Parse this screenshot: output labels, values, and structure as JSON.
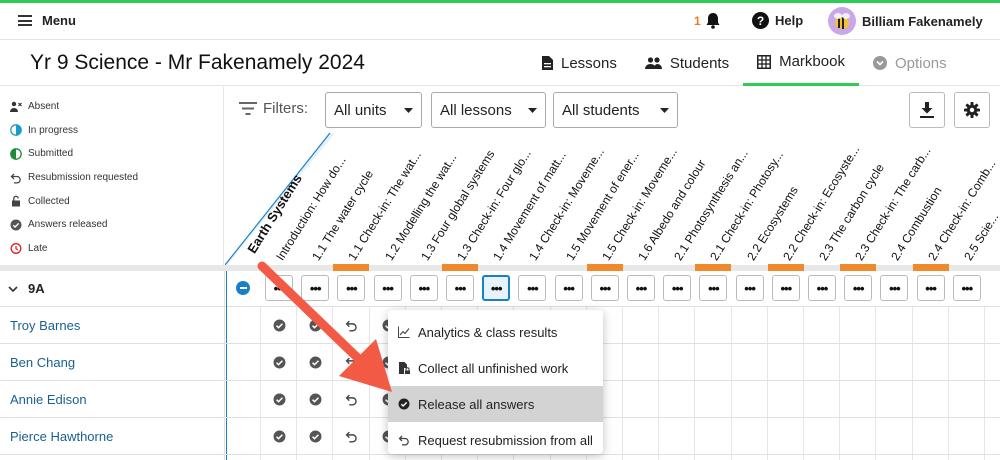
{
  "topbar": {
    "menu_label": "Menu",
    "notification_count": "1",
    "help_label": "Help",
    "user_name": "Billiam Fakenamely"
  },
  "header": {
    "title": "Yr 9 Science - Mr Fakenamely 2024",
    "tabs": [
      {
        "label": "Lessons",
        "icon": "document-icon"
      },
      {
        "label": "Students",
        "icon": "people-icon"
      },
      {
        "label": "Markbook",
        "icon": "grid-icon",
        "active": true
      },
      {
        "label": "Options",
        "icon": "chevron-circle-icon",
        "disabled": true
      }
    ]
  },
  "legend": [
    {
      "label": "Absent",
      "icon": "absent-icon"
    },
    {
      "label": "In progress",
      "icon": "half-circle-blue-icon"
    },
    {
      "label": "Submitted",
      "icon": "half-circle-green-icon"
    },
    {
      "label": "Resubmission requested",
      "icon": "undo-icon"
    },
    {
      "label": "Collected",
      "icon": "lock-icon"
    },
    {
      "label": "Answers released",
      "icon": "check-circle-icon"
    },
    {
      "label": "Late",
      "icon": "clock-icon"
    }
  ],
  "filters": {
    "label": "Filters:",
    "units": "All units",
    "lessons": "All lessons",
    "students": "All students"
  },
  "unit_name": "Earth Systems",
  "columns": [
    "Introduction: How do...",
    "1.1 The water cycle",
    "1.1 Check-in: The wat...",
    "1.2 Modelling the wat...",
    "1.3 Four global systems",
    "1.3 Check-in: Four glo...",
    "1.4 Movement of matt...",
    "1.4 Check-in: Moveme...",
    "1.5 Movement of ener...",
    "1.5 Check-in: Moveme...",
    "1.6 Albedo and colour",
    "2.1 Photosynthesis an...",
    "2.1 Check-in: Photosy...",
    "2.2 Ecosystems",
    "2.2 Check-in: Ecosyste...",
    "2.3 The carbon cycle",
    "2.3 Check-in: The carb...",
    "2.4 Combustion",
    "2.4 Check-in: Comb...",
    "2.5 Scie..."
  ],
  "dots_label": "•••",
  "group": {
    "name": "9A"
  },
  "students": [
    {
      "name": "Troy Barnes"
    },
    {
      "name": "Ben Chang"
    },
    {
      "name": "Annie Edison"
    },
    {
      "name": "Pierce Hawthorne"
    }
  ],
  "context_menu": [
    {
      "label": "Analytics & class results",
      "icon": "chart-icon"
    },
    {
      "label": "Collect all unfinished work",
      "icon": "doc-lock-icon"
    },
    {
      "label": "Release all answers",
      "icon": "check-circle-icon"
    },
    {
      "label": "Request resubmission from all",
      "icon": "undo-icon"
    }
  ],
  "colors": {
    "accent_green": "#2ecc55",
    "accent_blue": "#1b7fc4",
    "orange": "#f0892c",
    "arrow": "#f25a45"
  }
}
